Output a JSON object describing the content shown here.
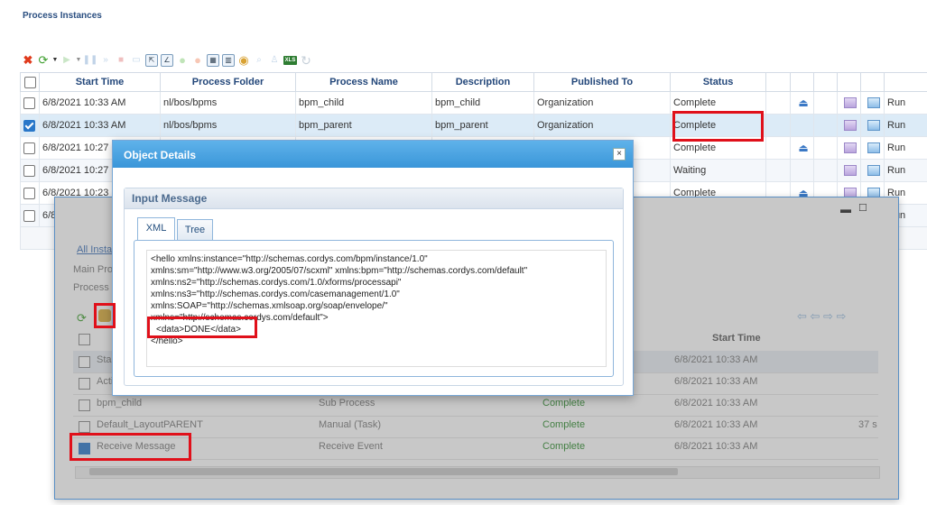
{
  "page": {
    "title": "Process Instances"
  },
  "toolbar": {
    "excel_label": "XLS"
  },
  "grid": {
    "headers": [
      "Start Time",
      "Process Folder",
      "Process Name",
      "Description",
      "Published To",
      "Status"
    ],
    "rows": [
      {
        "start": "6/8/2021 10:33 AM",
        "folder": "nl/bos/bpms",
        "name": "bpm_child",
        "desc": "bpm_child",
        "published": "Organization",
        "status": "Complete",
        "run": "Run",
        "checked": false
      },
      {
        "start": "6/8/2021 10:33 AM",
        "folder": "nl/bos/bpms",
        "name": "bpm_parent",
        "desc": "bpm_parent",
        "published": "Organization",
        "status": "Complete",
        "run": "Run",
        "checked": true
      },
      {
        "start": "6/8/2021 10:27 ",
        "folder": "",
        "name": "",
        "desc": "",
        "published": "",
        "status": "Complete",
        "run": "Run",
        "checked": false
      },
      {
        "start": "6/8/2021 10:27 ",
        "folder": "",
        "name": "",
        "desc": "",
        "published": "",
        "status": "Waiting",
        "run": "Run",
        "checked": false
      },
      {
        "start": "6/8/2021 10:23 ",
        "folder": "",
        "name": "",
        "desc": "",
        "published": "",
        "status": "Complete",
        "run": "Run",
        "checked": false
      },
      {
        "start": "6/8",
        "folder": "",
        "name": "",
        "desc": "",
        "published": "",
        "status": "",
        "run": "Run",
        "checked": false
      }
    ]
  },
  "window2": {
    "link": "All Insta",
    "label1": "Main Pro",
    "label2": "Process",
    "col_start": "Start Time",
    "rows": [
      {
        "name": "Sta",
        "type": "",
        "status": "",
        "start": "6/8/2021 10:33 AM",
        "extra": ""
      },
      {
        "name": "Acti",
        "type": "",
        "status": "",
        "start": "6/8/2021 10:33 AM",
        "extra": ""
      },
      {
        "name": "bpm_child",
        "type": "Sub Process",
        "status": "Complete",
        "start": "6/8/2021 10:33 AM",
        "extra": ""
      },
      {
        "name": "Default_LayoutPARENT",
        "type": "Manual (Task)",
        "status": "Complete",
        "start": "6/8/2021 10:33 AM",
        "extra": "37 s"
      },
      {
        "name": "Receive Message",
        "type": "Receive Event",
        "status": "Complete",
        "start": "6/8/2021 10:33 AM",
        "extra": ""
      }
    ]
  },
  "dialog": {
    "title": "Object Details",
    "close": "×",
    "panel_title": "Input Message",
    "tabs": [
      "XML",
      "Tree"
    ],
    "xml_lines": [
      "<hello xmlns:instance=\"http://schemas.cordys.com/bpm/instance/1.0\"",
      "xmlns:sm=\"http://www.w3.org/2005/07/scxml\" xmlns:bpm=\"http://schemas.cordys.com/default\"",
      "xmlns:ns2=\"http://schemas.cordys.com/1.0/xforms/processapi\"",
      "xmlns:ns3=\"http://schemas.cordys.com/casemanagement/1.0\"",
      "xmlns:SOAP=\"http://schemas.xmlsoap.org/soap/envelope/\"",
      "xmlns=\"http://schemas.cordys.com/default\">",
      "<data>DONE</data>",
      "</hello>"
    ]
  }
}
